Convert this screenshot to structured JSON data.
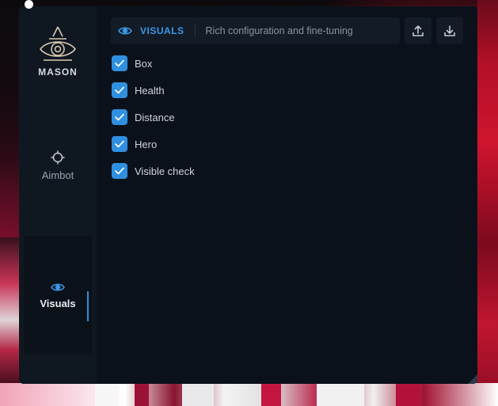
{
  "app": {
    "brand": "MASON"
  },
  "sidebar": {
    "items": [
      {
        "label": "Aimbot",
        "icon": "crosshair-icon",
        "active": false
      },
      {
        "label": "Visuals",
        "icon": "eye-icon",
        "active": true
      }
    ]
  },
  "header": {
    "section_title": "VISUALS",
    "section_description": "Rich configuration and fine-tuning",
    "actions": [
      {
        "icon": "upload-icon"
      },
      {
        "icon": "download-icon"
      }
    ]
  },
  "options": [
    {
      "label": "Box",
      "checked": true
    },
    {
      "label": "Health",
      "checked": true
    },
    {
      "label": "Distance",
      "checked": true
    },
    {
      "label": "Hero",
      "checked": true
    },
    {
      "label": "Visible check",
      "checked": true
    }
  ],
  "colors": {
    "accent": "#2f8fe0",
    "sidebar_bg": "#0f1721",
    "window_bg": "#0b111a",
    "panel_bg": "#121b26",
    "text_primary": "#e8ecf2",
    "text_muted": "#8b94a0"
  }
}
